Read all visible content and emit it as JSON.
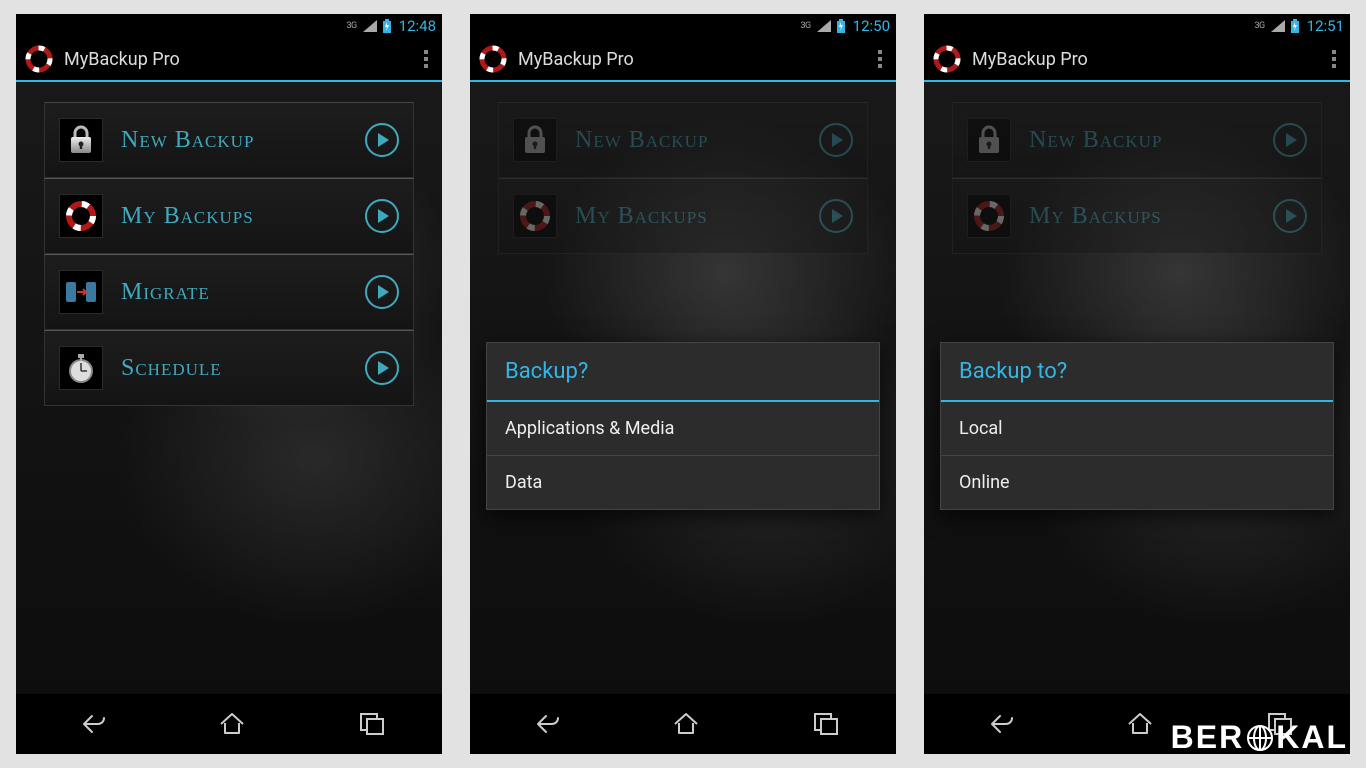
{
  "screens": {
    "s1": {
      "network": "3G",
      "time": "12:48",
      "app_title": "MyBackup Pro"
    },
    "s2": {
      "network": "3G",
      "time": "12:50",
      "app_title": "MyBackup Pro"
    },
    "s3": {
      "network": "3G",
      "time": "12:51",
      "app_title": "MyBackup Pro"
    }
  },
  "menu": {
    "new_backup": "New Backup",
    "my_backups": "My Backups",
    "migrate": "Migrate",
    "schedule": "Schedule"
  },
  "dialog1": {
    "title": "Backup?",
    "opt1": "Applications & Media",
    "opt2": "Data"
  },
  "dialog2": {
    "title": "Backup to?",
    "opt1": "Local",
    "opt2": "Online"
  },
  "watermark": "BER   KAL"
}
